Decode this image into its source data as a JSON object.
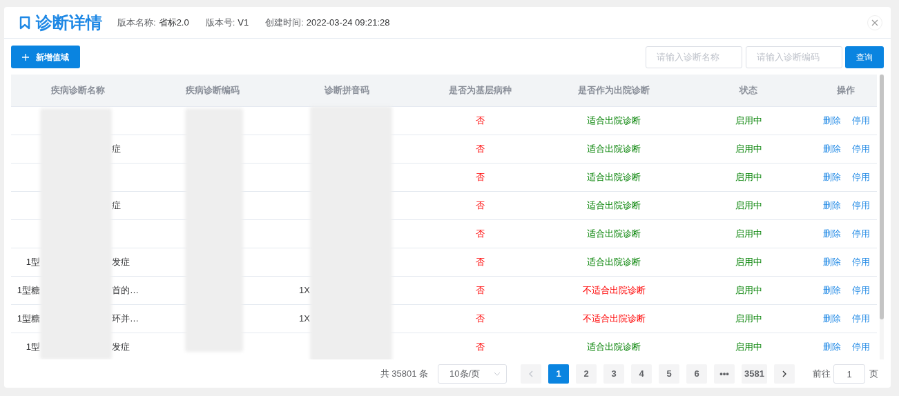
{
  "dialog": {
    "title": "诊断详情",
    "meta": [
      {
        "label": "版本名称:",
        "value": "省标2.0"
      },
      {
        "label": "版本号:",
        "value": "V1"
      },
      {
        "label": "创建时间:",
        "value": "2022-03-24 09:21:28"
      }
    ]
  },
  "toolbar": {
    "add_button": "新增值域",
    "name_search": {
      "placeholder": "请输入诊断名称"
    },
    "code_search": {
      "placeholder": "请输入诊断编码"
    },
    "query_button": "查询"
  },
  "table": {
    "columns": [
      "疾病诊断名称",
      "疾病诊断编码",
      "诊断拼音码",
      "是否为基层病种",
      "是否作为出院诊断",
      "状态",
      "操作"
    ],
    "rows": [
      {
        "name_start": "",
        "name_end": "",
        "pinyin_start": "",
        "basic": "否",
        "discharge": "适合出院诊断",
        "suitable": true,
        "status": "启用中",
        "actions": [
          "删除",
          "停用"
        ]
      },
      {
        "name_start": "",
        "name_end": "症",
        "pinyin_start": "",
        "basic": "否",
        "discharge": "适合出院诊断",
        "suitable": true,
        "status": "启用中",
        "actions": [
          "删除",
          "停用"
        ]
      },
      {
        "name_start": "",
        "name_end": "",
        "pinyin_start": "",
        "basic": "否",
        "discharge": "适合出院诊断",
        "suitable": true,
        "status": "启用中",
        "actions": [
          "删除",
          "停用"
        ]
      },
      {
        "name_start": "",
        "name_end": "症",
        "pinyin_start": "",
        "basic": "否",
        "discharge": "适合出院诊断",
        "suitable": true,
        "status": "启用中",
        "actions": [
          "删除",
          "停用"
        ]
      },
      {
        "name_start": "",
        "name_end": "",
        "pinyin_start": "",
        "basic": "否",
        "discharge": "适合出院诊断",
        "suitable": true,
        "status": "启用中",
        "actions": [
          "删除",
          "停用"
        ]
      },
      {
        "name_start": "1型",
        "name_end": "发症",
        "pinyin_start": "",
        "basic": "否",
        "discharge": "适合出院诊断",
        "suitable": true,
        "status": "启用中",
        "actions": [
          "删除",
          "停用"
        ]
      },
      {
        "name_start": "1型糖",
        "name_end": "首的…",
        "pinyin_start": "1X",
        "basic": "否",
        "discharge": "不适合出院诊断",
        "suitable": false,
        "status": "启用中",
        "actions": [
          "删除",
          "停用"
        ]
      },
      {
        "name_start": "1型糖",
        "name_end": "环并…",
        "pinyin_start": "1X",
        "basic": "否",
        "discharge": "不适合出院诊断",
        "suitable": false,
        "status": "启用中",
        "actions": [
          "删除",
          "停用"
        ]
      },
      {
        "name_start": "1型",
        "name_end": "发症",
        "pinyin_start": "",
        "basic": "否",
        "discharge": "适合出院诊断",
        "suitable": true,
        "status": "启用中",
        "actions": [
          "删除",
          "停用"
        ]
      }
    ]
  },
  "pagination": {
    "total": "共 35801 条",
    "page_size": "10条/页",
    "pages": [
      {
        "label": "1",
        "selected": true
      },
      {
        "label": "2",
        "selected": false
      },
      {
        "label": "3",
        "selected": false
      },
      {
        "label": "4",
        "selected": false
      },
      {
        "label": "5",
        "selected": false
      },
      {
        "label": "6",
        "selected": false
      },
      {
        "label": "•••",
        "selected": false
      },
      {
        "label": "3581",
        "selected": false
      }
    ],
    "jump_label": "前往",
    "jump_value": "1",
    "jump_unit": "页"
  }
}
